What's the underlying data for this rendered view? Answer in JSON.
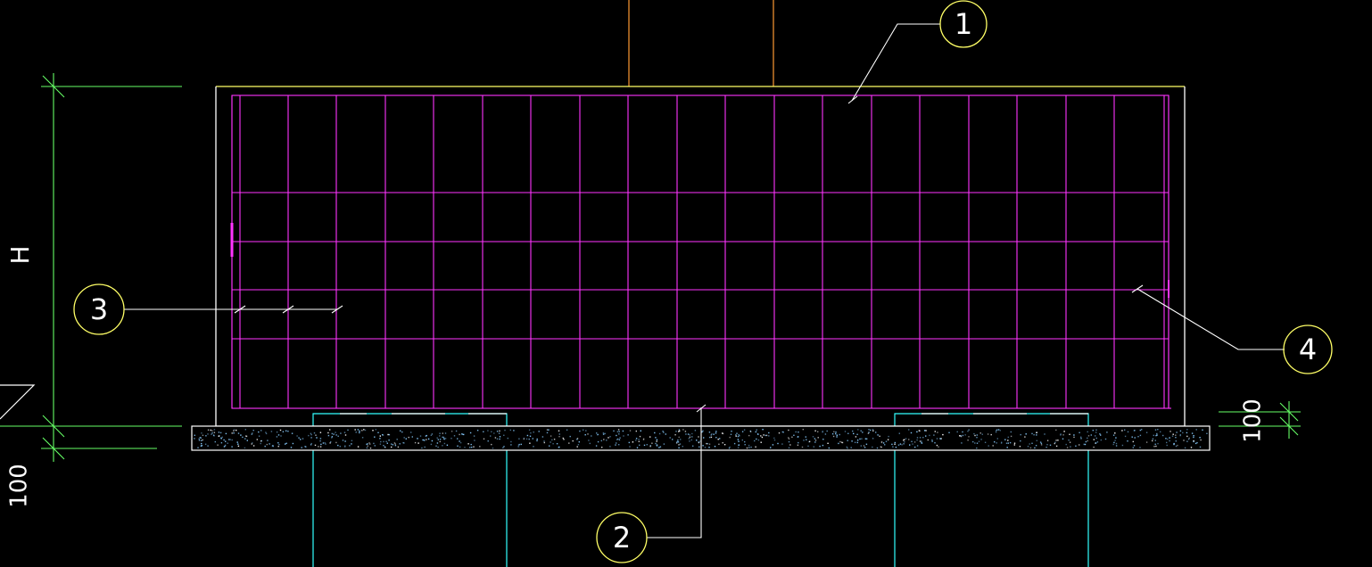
{
  "drawing": {
    "colors": {
      "background": "#000000",
      "outline": "#ffffff",
      "top_edge": "#ffff66",
      "rebar": "#ff33ff",
      "dimension": "#66ff66",
      "column_top": "#ff9933",
      "column_bottom": "#33ffff",
      "callout": "#ffff66",
      "text": "#ffffff",
      "concrete_dots": "#88ccff"
    },
    "dimensions": {
      "height_label": "H",
      "left_bottom_label": "100",
      "right_label": "100"
    },
    "callouts": [
      {
        "id": "callout-1",
        "number": "1"
      },
      {
        "id": "callout-2",
        "number": "2"
      },
      {
        "id": "callout-3",
        "number": "3"
      },
      {
        "id": "callout-4",
        "number": "4"
      }
    ]
  }
}
